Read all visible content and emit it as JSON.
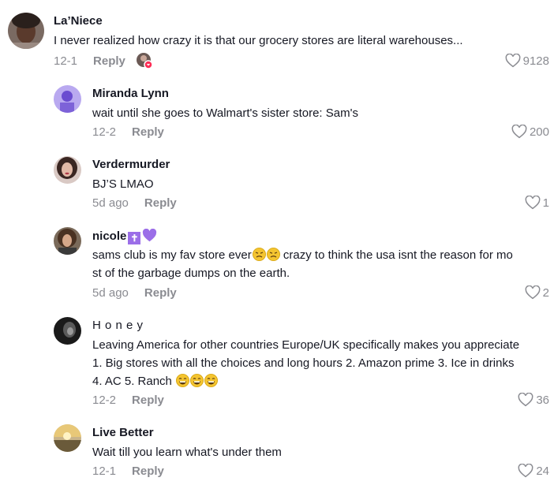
{
  "comments": [
    {
      "name": "La’Niece",
      "text": "I never realized how crazy it is that our grocery stores are literal warehouses...",
      "date": "12-1",
      "reply_label": "Reply",
      "likes": "9128"
    },
    {
      "name": "Miranda Lynn",
      "text": "wait until she goes to Walmart's sister store: Sam's",
      "date": "12-2",
      "reply_label": "Reply",
      "likes": "200"
    },
    {
      "name": "Verdermurder",
      "text": "BJ’S LMAO",
      "date": "5d ago",
      "reply_label": "Reply",
      "likes": "1"
    },
    {
      "name": "nicole",
      "text_before": "sams club is my fav store ever",
      "text_after": " crazy to think the usa isnt the reason for mo",
      "text_line2": "st of the garbage dumps on the earth.",
      "date": "5d ago",
      "reply_label": "Reply",
      "likes": "2"
    },
    {
      "name": "H o n e y",
      "text_line1": "Leaving America for other countries Europe/UK specifically makes you appreciate",
      "text_line2": "1. Big stores with all the choices and long hours 2. Amazon prime 3. Ice in drinks",
      "text_line3": "4. AC 5. Ranch",
      "date": "12-2",
      "reply_label": "Reply",
      "likes": "36"
    },
    {
      "name": "Live Better",
      "text": "Wait till you learn what's under them",
      "date": "12-1",
      "reply_label": "Reply",
      "likes": "24"
    }
  ],
  "icons": {
    "like": "heart-outline-icon",
    "emoji_angry": "persevering-face-emoji",
    "emoji_laugh": "grinning-sweat-emoji",
    "badge": "latin-cross-icon",
    "heart": "purple-heart-icon"
  },
  "colors": {
    "text": "#161823",
    "muted": "#8a8b91",
    "badge": "#9b6ee8"
  }
}
